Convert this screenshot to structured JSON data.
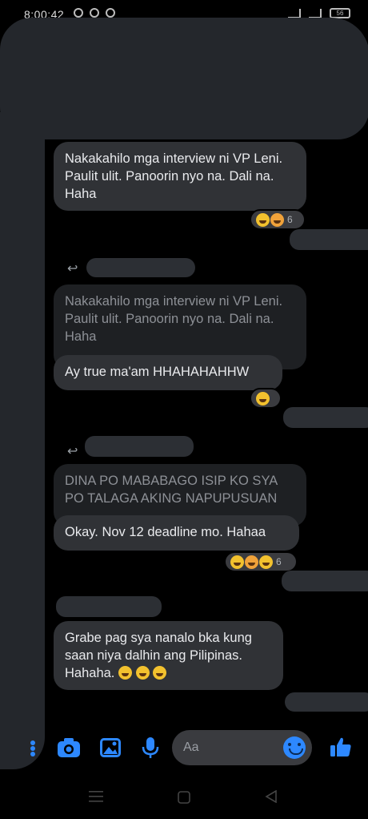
{
  "status_bar": {
    "time": "8:00:42",
    "battery": "56"
  },
  "messages": [
    {
      "text": "Nakakahilo mga interview ni VP Leni. Paulit ulit. Panoorin nyo na. Dali na. Haha",
      "reaction_count": "6"
    },
    {
      "quoted": "Nakakahilo mga interview ni VP Leni. Paulit ulit. Panoorin nyo na. Dali na. Haha",
      "text": "Ay true ma'am HHAHAHAHHW"
    },
    {
      "quoted": "DINA PO MABABAGO ISIP KO SYA PO TALAGA AKING NAPUPUSUAN",
      "text": "Okay. Nov 12 deadline mo. Hahaa",
      "reaction_count": "6"
    },
    {
      "text": "Grabe pag sya nanalo bka kung saan niya dalhin ang Pilipinas. Hahaha."
    }
  ],
  "composer": {
    "placeholder": "Aa"
  },
  "colors": {
    "accent": "#2d88ff",
    "bubble": "#303236",
    "quoted_bubble": "#1e2023",
    "redaction": "#24272c"
  },
  "icons": [
    "camera-icon",
    "gallery-icon",
    "microphone-icon",
    "emoji-icon",
    "thumbs-up-icon",
    "menu-icon",
    "home-icon",
    "back-icon"
  ]
}
